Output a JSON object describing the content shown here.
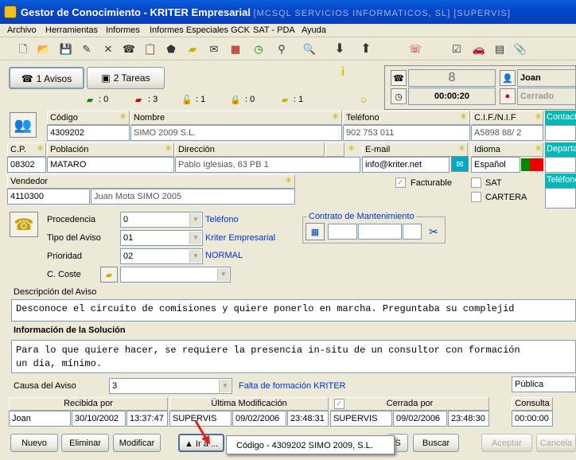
{
  "window": {
    "title": "Gestor de Conocimiento - KRITER Empresarial",
    "subtitle": "[MCSQL SERVICIOS INFORMATICOS, SL] [SUPERVIS]"
  },
  "menu": [
    "Archivo",
    "Herramientas",
    "Informes",
    "Informes Especiales GCK",
    "SAT - PDA",
    "Ayuda"
  ],
  "tabs": {
    "avisos": "1 Avisos",
    "tareas": "2 Tareas"
  },
  "counters": [
    ": 0",
    ": 3",
    ": 1",
    ": 0",
    ": 1"
  ],
  "status_panel": {
    "count": "8",
    "user": "Joan",
    "timer": "00:00:20",
    "state": "Cerrado"
  },
  "client": {
    "codigo_label": "Código",
    "codigo": "4309202",
    "nombre_label": "Nombre",
    "nombre": "SIMO 2009 S.L.",
    "telefono_label": "Teléfono",
    "telefono": "902 753 011",
    "cif_label": "C.I.F./N.I.F",
    "cif": "A5898 88/ 2",
    "contact_label": "Contact",
    "cp_label": "C.P.",
    "cp": "08302",
    "poblacion_label": "Población",
    "poblacion": "MATARO",
    "direccion_label": "Dirección",
    "direccion": "Pablo Iglesias, 63 PB 1",
    "email_label": "E-mail",
    "email": "info@kriter.net",
    "idioma_label": "Idioma",
    "idioma": "Español",
    "departa_label": "Departa",
    "vendedor_label": "Vendedor",
    "vendedor_code": "4110300",
    "vendedor_name": "Juan Mota SIMO 2005",
    "facturable_label": "Facturable",
    "sat_label": "SAT",
    "cartera_label": "CARTERA",
    "telefono2_label": "Teléfono"
  },
  "aviso": {
    "procedencia_label": "Procedencia",
    "procedencia": "0",
    "procedencia_desc": "Teléfono",
    "tipo_label": "Tipo del Aviso",
    "tipo": "01",
    "tipo_desc": "Kriter Empresarial",
    "prioridad_label": "Prioridad",
    "prioridad": "02",
    "prioridad_desc": "NORMAL",
    "coste_label": "C. Coste",
    "contrato_label": "Contrato de Mantenimiento",
    "descripcion_label": "Descripción del Aviso",
    "descripcion": "Desconoce el circuito de comisiones y quiere ponerlo en marcha.  Preguntaba su complejid",
    "solucion_label": "Información de la Solución",
    "solucion_line1": "Para lo que quiere hacer, se requiere la presencia in-situ de un consultor con formación",
    "solucion_line2": "un dia, mínimo.",
    "causa_label": "Causa del Aviso",
    "causa": "3",
    "causa_desc": "Falta de formación KRITER",
    "visibilidad": "Pública"
  },
  "history": {
    "recibida_label": "Recibida por",
    "recibida_user": "Joan",
    "recibida_date": "30/10/2002",
    "recibida_time": "13:37:47",
    "modif_label": "Última Modificación",
    "modif_user": "SUPERVIS",
    "modif_date": "09/02/2006",
    "modif_time": "23:48:31",
    "cerrada_label": "Cerrada por",
    "cerrada_user": "SUPERVIS",
    "cerrada_date": "09/02/2006",
    "cerrada_time": "23:48:30",
    "consulta_label": "Consulta",
    "consulta_time": "00:00:00"
  },
  "buttons": {
    "nuevo": "Nuevo",
    "eliminar": "Eliminar",
    "modificar": "Modificar",
    "ira": "▲ Ir a ...",
    "s": "S",
    "buscar": "Buscar",
    "aceptar": "Aceptar",
    "cancelar": "Cancela"
  },
  "popup": {
    "item": "Código - 4309202 SIMO 2009, S.L."
  },
  "colors": {
    "titlebar": "#0347c9",
    "link": "#0033cc",
    "cyan": "#00b8b8",
    "arrow": "#e02020"
  }
}
